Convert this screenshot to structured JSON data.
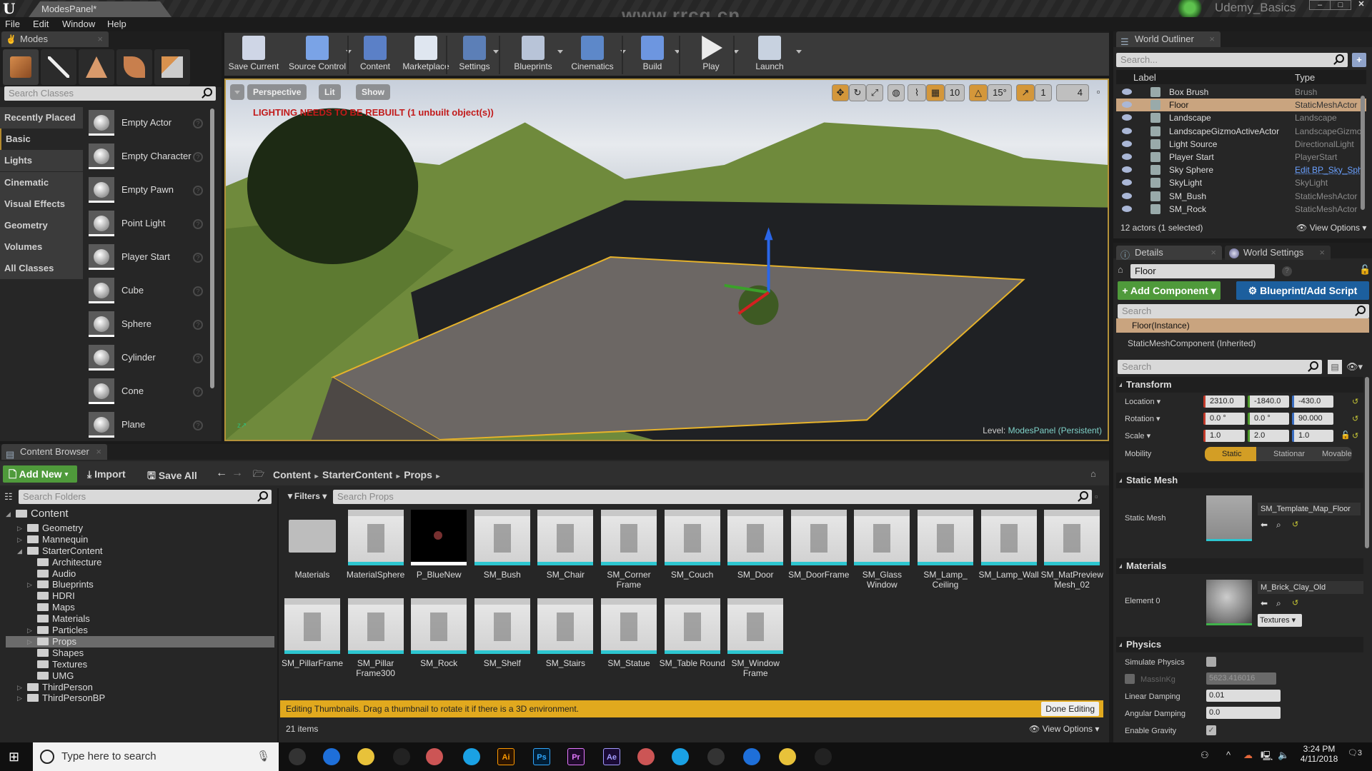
{
  "window": {
    "document_tab": "ModesPanel*",
    "watermark": "www.rrcg.cn",
    "project_name": "Udemy_Basics",
    "controls": [
      "minimize",
      "maximize",
      "close"
    ]
  },
  "menu": [
    "File",
    "Edit",
    "Window",
    "Help"
  ],
  "modes_panel": {
    "tab_label": "Modes",
    "tools": [
      "place-mode",
      "paint-mode",
      "landscape-mode",
      "foliage-mode",
      "geometry-mode"
    ],
    "search_placeholder": "Search Classes",
    "categories": [
      "Recently Placed",
      "Basic",
      "Lights",
      "Cinematic",
      "Visual Effects",
      "Geometry",
      "Volumes",
      "All Classes"
    ],
    "selected_category": "Basic",
    "items": [
      "Empty Actor",
      "Empty Character",
      "Empty Pawn",
      "Point Light",
      "Player Start",
      "Cube",
      "Sphere",
      "Cylinder",
      "Cone",
      "Plane"
    ]
  },
  "toolbar": {
    "buttons": [
      {
        "label": "Save Current",
        "icon": "save-icon",
        "dropdown": false
      },
      {
        "label": "Source Control",
        "icon": "source-control-icon",
        "dropdown": true
      },
      {
        "label": "Content",
        "icon": "content-icon",
        "dropdown": false
      },
      {
        "label": "Marketplace",
        "icon": "marketplace-icon",
        "dropdown": false
      },
      {
        "label": "Settings",
        "icon": "gear-icon",
        "dropdown": true
      },
      {
        "label": "Blueprints",
        "icon": "blueprints-icon",
        "dropdown": true
      },
      {
        "label": "Cinematics",
        "icon": "clapperboard-icon",
        "dropdown": true
      },
      {
        "label": "Build",
        "icon": "build-icon",
        "dropdown": true
      },
      {
        "label": "Play",
        "icon": "play-icon",
        "dropdown": true
      },
      {
        "label": "Launch",
        "icon": "launch-icon",
        "dropdown": true
      }
    ]
  },
  "viewport": {
    "view_mode": "Perspective",
    "lighting_mode": "Lit",
    "show_label": "Show",
    "warning": "LIGHTING NEEDS TO BE REBUILT (1 unbuilt object(s))",
    "grid_snap": "10",
    "rotation_snap": "15°",
    "scale_snap": "1",
    "camera_speed": "4",
    "level_label": "Level:",
    "level_name": "ModesPanel (Persistent)"
  },
  "world_outliner": {
    "tab_label": "World Outliner",
    "search_placeholder": "Search...",
    "col_label": "Label",
    "col_type": "Type",
    "rows": [
      {
        "label": "Box Brush",
        "type": "Brush",
        "selected": false
      },
      {
        "label": "Floor",
        "type": "StaticMeshActor",
        "selected": true
      },
      {
        "label": "Landscape",
        "type": "Landscape",
        "selected": false
      },
      {
        "label": "LandscapeGizmoActiveActor",
        "type": "LandscapeGizmoActiveActor",
        "selected": false
      },
      {
        "label": "Light Source",
        "type": "DirectionalLight",
        "selected": false
      },
      {
        "label": "Player Start",
        "type": "PlayerStart",
        "selected": false
      },
      {
        "label": "Sky Sphere",
        "type": "Edit BP_Sky_Sphere",
        "selected": false,
        "link": true
      },
      {
        "label": "SkyLight",
        "type": "SkyLight",
        "selected": false
      },
      {
        "label": "SM_Bush",
        "type": "StaticMeshActor",
        "selected": false
      },
      {
        "label": "SM_Rock",
        "type": "StaticMeshActor",
        "selected": false
      }
    ],
    "status": "12 actors (1 selected)",
    "view_options": "View Options"
  },
  "details": {
    "tab_label": "Details",
    "tab2_label": "World Settings",
    "actor_name": "Floor",
    "add_component": "+ Add Component",
    "blueprint_script": "Blueprint/Add Script",
    "search_placeholder": "Search",
    "component_root": "Floor(Instance)",
    "component_child": "StaticMeshComponent (Inherited)",
    "transform": {
      "title": "Transform",
      "location_label": "Location",
      "location": [
        "2310.0",
        "-1840.0",
        "-430.0"
      ],
      "rotation_label": "Rotation",
      "rotation": [
        "0.0 °",
        "0.0 °",
        "90.000"
      ],
      "scale_label": "Scale",
      "scale": [
        "1.0",
        "2.0",
        "1.0"
      ],
      "mobility_label": "Mobility",
      "mobility_options": [
        "Static",
        "Stationary",
        "Movable"
      ],
      "mobility_selected": "Static"
    },
    "static_mesh": {
      "title": "Static Mesh",
      "label": "Static Mesh",
      "value": "SM_Template_Map_Floor"
    },
    "materials": {
      "title": "Materials",
      "label": "Element 0",
      "value": "M_Brick_Clay_Old",
      "textures_btn": "Textures"
    },
    "physics": {
      "title": "Physics",
      "simulate_label": "Simulate Physics",
      "simulate": false,
      "mass_label": "MassInKg",
      "mass": "5623.416016",
      "linear_damping_label": "Linear Damping",
      "linear_damping": "0.01",
      "angular_damping_label": "Angular Damping",
      "angular_damping": "0.0",
      "gravity_label": "Enable Gravity",
      "gravity": true
    }
  },
  "content_browser": {
    "tab_label": "Content Browser",
    "add_new": "Add New",
    "import": "Import",
    "save_all": "Save All",
    "breadcrumb": [
      "Content",
      "StarterContent",
      "Props"
    ],
    "folder_search_placeholder": "Search Folders",
    "filters": "Filters",
    "asset_search_placeholder": "Search Props",
    "tree": [
      {
        "name": "Content",
        "level": 0,
        "expanded": true
      },
      {
        "name": "Geometry",
        "level": 1,
        "collapsible": true
      },
      {
        "name": "Mannequin",
        "level": 1,
        "collapsible": true
      },
      {
        "name": "StarterContent",
        "level": 1,
        "expanded": true
      },
      {
        "name": "Architecture",
        "level": 2
      },
      {
        "name": "Audio",
        "level": 2
      },
      {
        "name": "Blueprints",
        "level": 2,
        "collapsible": true
      },
      {
        "name": "HDRI",
        "level": 2
      },
      {
        "name": "Maps",
        "level": 2
      },
      {
        "name": "Materials",
        "level": 2
      },
      {
        "name": "Particles",
        "level": 2,
        "collapsible": true
      },
      {
        "name": "Props",
        "level": 2,
        "collapsible": true,
        "selected": true
      },
      {
        "name": "Shapes",
        "level": 2
      },
      {
        "name": "Textures",
        "level": 2
      },
      {
        "name": "UMG",
        "level": 2
      },
      {
        "name": "ThirdPerson",
        "level": 1,
        "collapsible": true
      },
      {
        "name": "ThirdPersonBP",
        "level": 1,
        "collapsible": true
      }
    ],
    "assets": [
      "Materials",
      "MaterialSphere",
      "P_BlueNew",
      "SM_Bush",
      "SM_Chair",
      "SM_Corner Frame",
      "SM_Couch",
      "SM_Door",
      "SM_DoorFrame",
      "SM_Glass Window",
      "SM_Lamp_ Ceiling",
      "SM_Lamp_Wall",
      "SM_MatPreview Mesh_02",
      "SM_PillarFrame",
      "SM_Pillar Frame300",
      "SM_Rock",
      "SM_Shelf",
      "SM_Stairs",
      "SM_Statue",
      "SM_Table Round",
      "SM_Window Frame"
    ],
    "banner": "Editing Thumbnails. Drag a thumbnail to rotate it if there is a 3D environment.",
    "done_editing": "Done Editing",
    "item_count": "21 items",
    "view_options": "View Options"
  },
  "taskbar": {
    "search_placeholder": "Type here to search",
    "apps": [
      "task-view",
      "edge",
      "chrome",
      "settings",
      "app",
      "skype",
      "Ai",
      "Ps",
      "Pr",
      "Ae",
      "app",
      "epic",
      "app",
      "app",
      "epic",
      "unreal"
    ],
    "time": "3:24 PM",
    "date": "4/11/2018",
    "notifications": "3"
  }
}
